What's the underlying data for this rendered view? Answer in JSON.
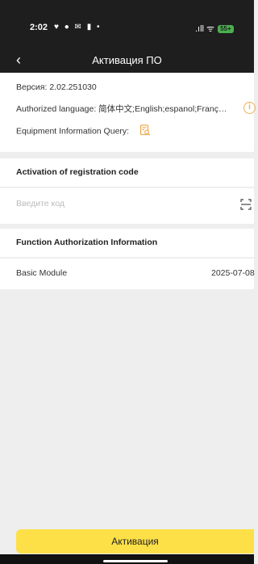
{
  "status_bar": {
    "time": "2:02",
    "notifications": "♥ ● ✉ ▮ •",
    "signal_wifi": ".ıll ᯤ",
    "battery": "55+"
  },
  "header": {
    "title": "Активация ПО"
  },
  "info": {
    "version_label": "Версия:",
    "version_value": "2.02.251030",
    "lang_label": "Authorized language:",
    "lang_value": "简体中文;English;espanol;Franç…",
    "query_label": "Equipment Information Query:"
  },
  "activation": {
    "section_title": "Activation of registration code",
    "code_placeholder": "Введите код",
    "code_value": ""
  },
  "function_auth": {
    "section_title": "Function Authorization Information",
    "modules": [
      {
        "name": "Basic Module",
        "date": "2025-07-08"
      }
    ]
  },
  "footer": {
    "activate_label": "Активация"
  },
  "colors": {
    "accent": "#fde047",
    "icon_orange": "#f0ad4e",
    "header_bg": "#1e1e1e"
  },
  "icons": {
    "back": "chevron-left-icon",
    "info": "info-icon",
    "query": "document-search-icon",
    "scan": "scan-icon"
  }
}
